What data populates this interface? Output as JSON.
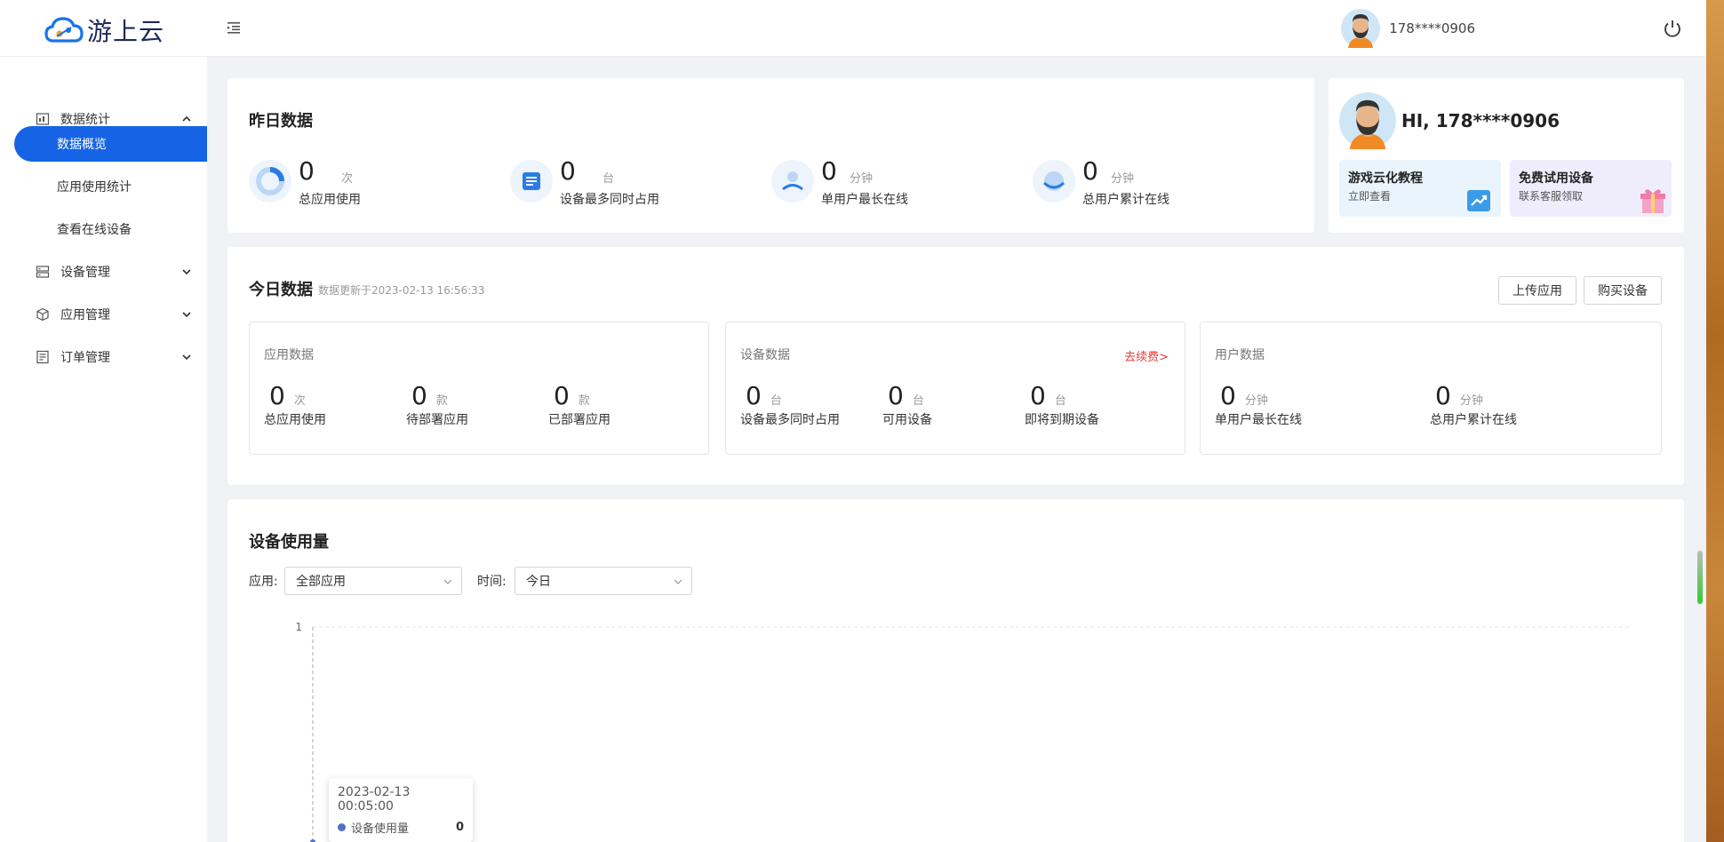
{
  "app": {
    "logo_text": "游上云"
  },
  "user": {
    "name": "178****0906"
  },
  "sidebar": {
    "groups": [
      {
        "label": "数据统计",
        "children": [
          "数据概览",
          "应用使用统计",
          "查看在线设备"
        ]
      },
      {
        "label": "设备管理"
      },
      {
        "label": "应用管理"
      },
      {
        "label": "订单管理"
      }
    ],
    "active": "数据概览"
  },
  "yesterday": {
    "title": "昨日数据",
    "stats": [
      {
        "value": "0",
        "unit": "次",
        "label": "总应用使用"
      },
      {
        "value": "0",
        "unit": "台",
        "label": "设备最多同时占用"
      },
      {
        "value": "0",
        "unit": "分钟",
        "label": "单用户最长在线"
      },
      {
        "value": "0",
        "unit": "分钟",
        "label": "总用户累计在线"
      }
    ]
  },
  "welcome": {
    "greeting": "HI, 178****0906",
    "cards": [
      {
        "title": "游戏云化教程",
        "sub": "立即查看"
      },
      {
        "title": "免费试用设备",
        "sub": "联系客服领取"
      }
    ]
  },
  "today": {
    "title": "今日数据",
    "updated": "数据更新于2023-02-13 16:56:33",
    "buttons": [
      "上传应用",
      "购买设备"
    ],
    "boxes": [
      {
        "title": "应用数据",
        "items": [
          {
            "value": "0",
            "unit": "次",
            "label": "总应用使用"
          },
          {
            "value": "0",
            "unit": "款",
            "label": "待部署应用"
          },
          {
            "value": "0",
            "unit": "款",
            "label": "已部署应用"
          }
        ]
      },
      {
        "title": "设备数据",
        "link": "去续费>",
        "items": [
          {
            "value": "0",
            "unit": "台",
            "label": "设备最多同时占用"
          },
          {
            "value": "0",
            "unit": "台",
            "label": "可用设备"
          },
          {
            "value": "0",
            "unit": "台",
            "label": "即将到期设备"
          }
        ]
      },
      {
        "title": "用户数据",
        "items": [
          {
            "value": "0",
            "unit": "分钟",
            "label": "单用户最长在线"
          },
          {
            "value": "0",
            "unit": "分钟",
            "label": "总用户累计在线"
          }
        ]
      }
    ]
  },
  "usage": {
    "title": "设备使用量",
    "filters": {
      "app_label": "应用:",
      "app_value": "全部应用",
      "time_label": "时间:",
      "time_value": "今日"
    },
    "tooltip": {
      "time": "2023-02-13 00:05:00",
      "series": "设备使用量",
      "value": "0"
    }
  },
  "chart_data": {
    "type": "line",
    "series": [
      {
        "name": "设备使用量",
        "values": [
          0
        ]
      }
    ],
    "x": [
      "2023-02-13 00:05:00"
    ],
    "ylim": [
      0,
      1
    ],
    "y_ticks": [
      "1"
    ]
  },
  "colors": {
    "primary": "#1664e5",
    "danger": "#e53c3c",
    "series": "#5470c6"
  },
  "icons": {
    "collapse": "menu-fold-icon",
    "power": "power-icon"
  }
}
